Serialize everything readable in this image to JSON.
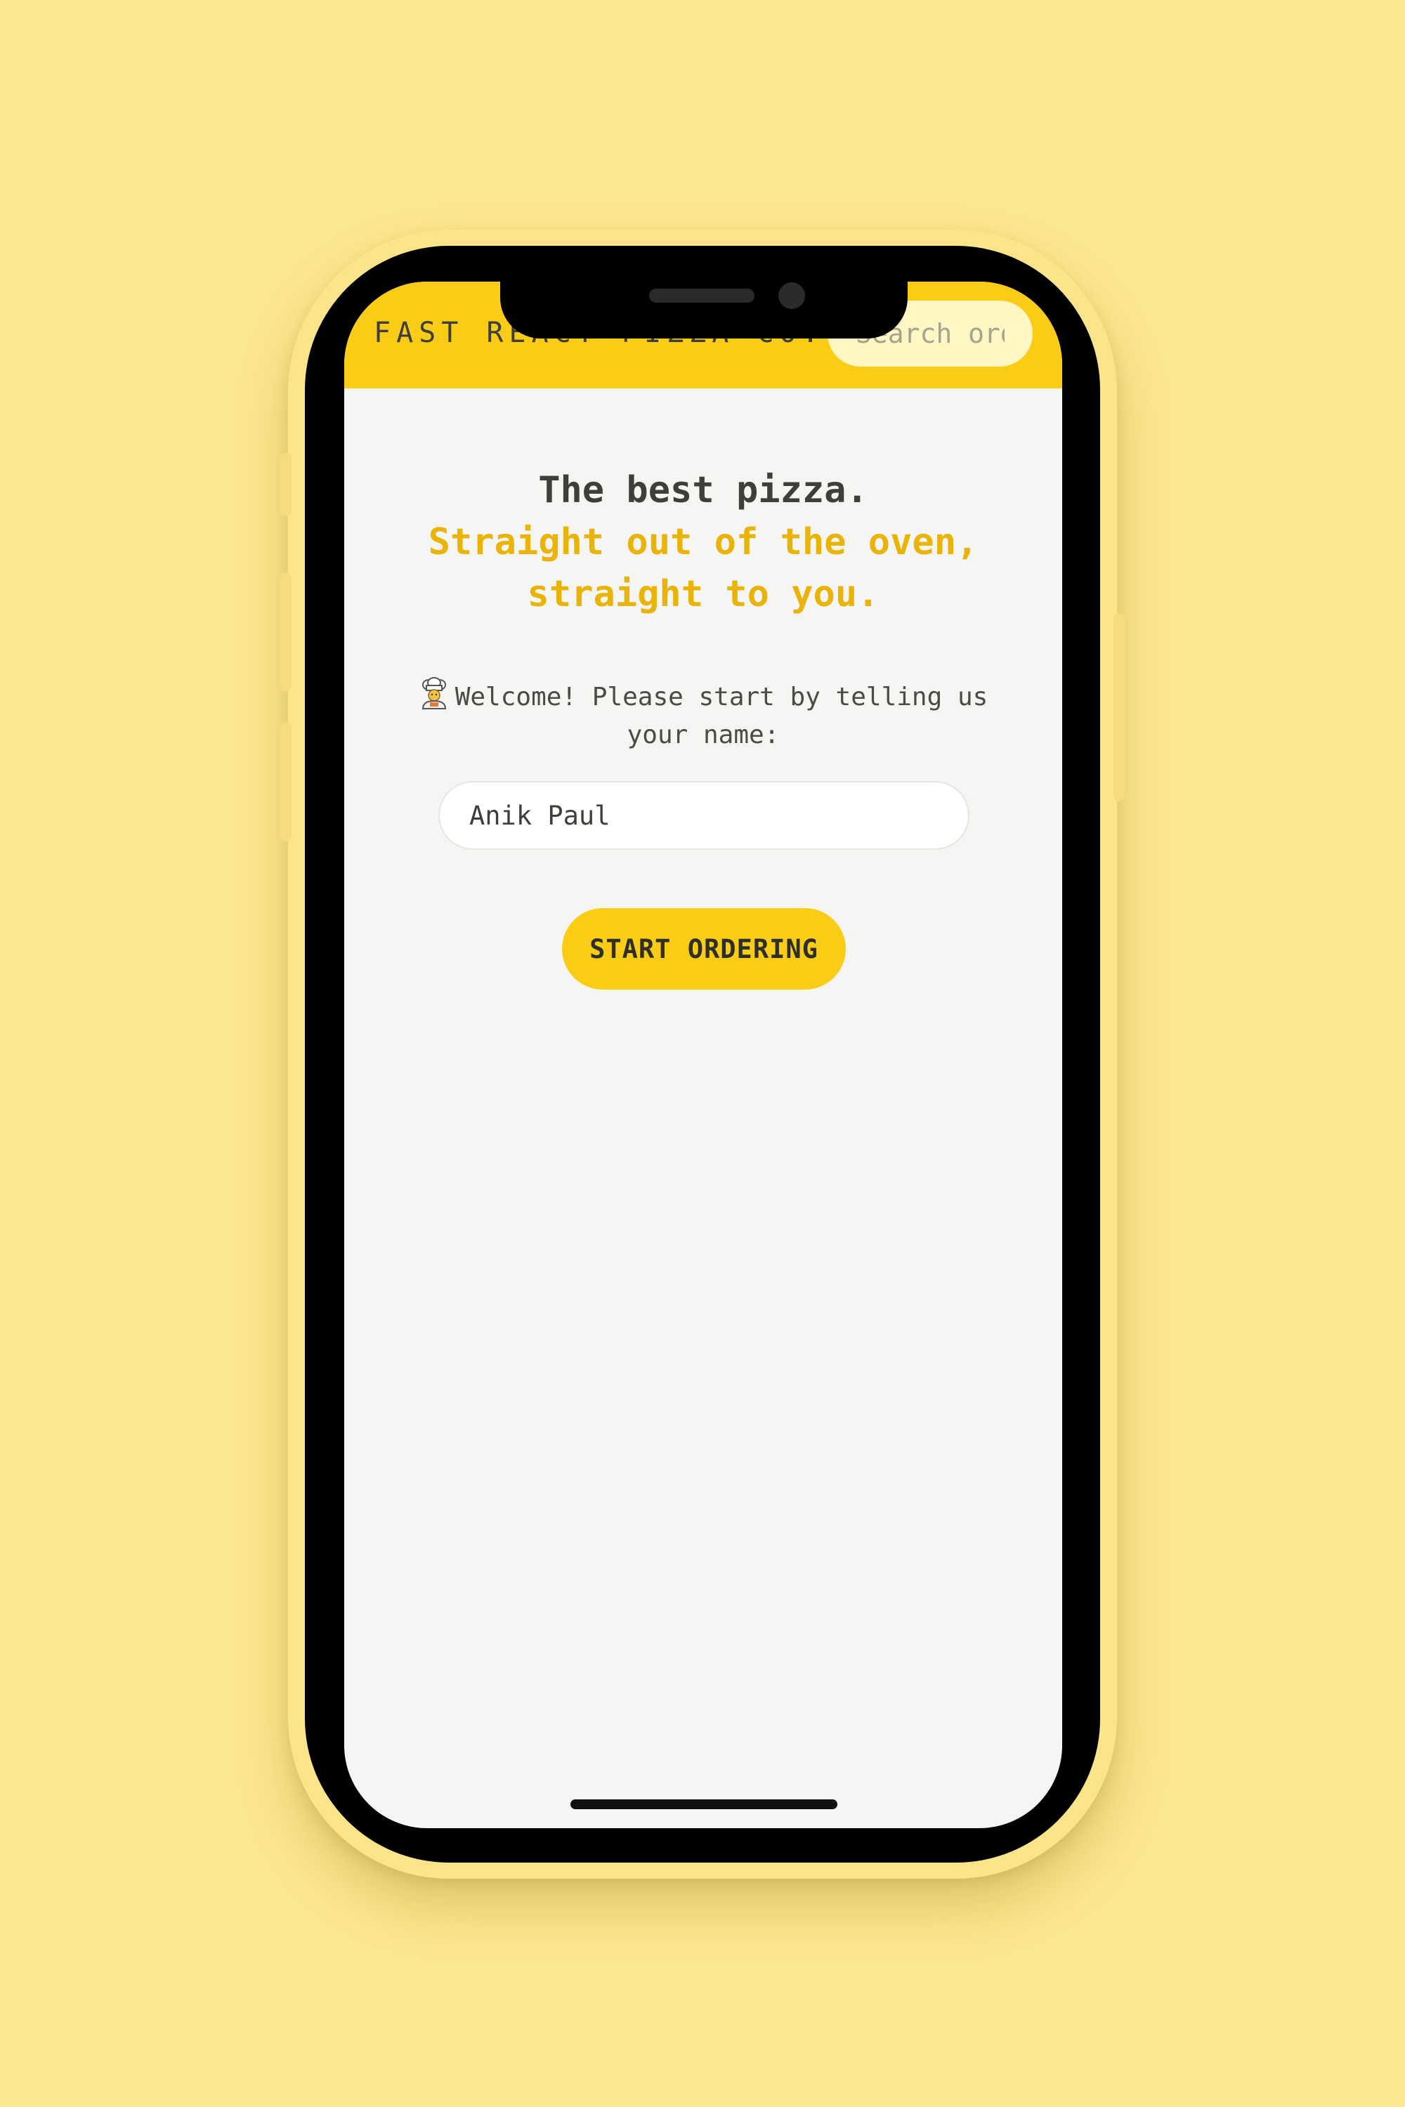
{
  "header": {
    "brand": "FAST REACT PIZZA CO.",
    "search_placeholder": "Search order #"
  },
  "hero": {
    "title": "The best pizza.",
    "subtitle_line1": "Straight out of the oven,",
    "subtitle_line2": "straight to you."
  },
  "welcome": {
    "icon": "chef-icon",
    "text": "Welcome! Please start by telling us your name:"
  },
  "form": {
    "name_value": "Anik Paul",
    "button_label": "START ORDERING"
  },
  "colors": {
    "background": "#fce68f",
    "accent": "#facc15",
    "accent_text": "#eab308",
    "text": "#3f3f3a",
    "screen_bg": "#f5f5f3"
  }
}
